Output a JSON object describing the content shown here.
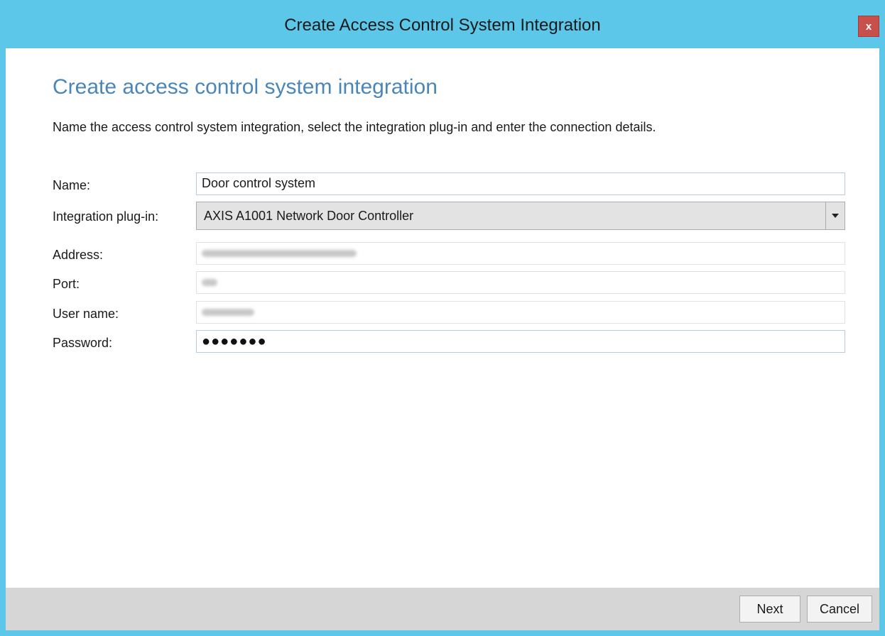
{
  "window": {
    "title": "Create Access Control System Integration",
    "close_label": "x"
  },
  "page": {
    "heading": "Create access control system integration",
    "subtitle": "Name the access control system integration, select the integration plug-in and enter the connection details."
  },
  "form": {
    "name_label": "Name:",
    "name_value": "Door control system",
    "plugin_label": "Integration plug-in:",
    "plugin_value": "AXIS A1001 Network Door Controller",
    "address_label": "Address:",
    "port_label": "Port:",
    "username_label": "User name:",
    "password_label": "Password:",
    "password_mask": "●●●●●●●"
  },
  "footer": {
    "next_label": "Next",
    "cancel_label": "Cancel"
  },
  "colors": {
    "titlebar": "#5cc7e8",
    "heading": "#4a86b8",
    "close": "#c7504c",
    "footer": "#d6d6d6"
  }
}
